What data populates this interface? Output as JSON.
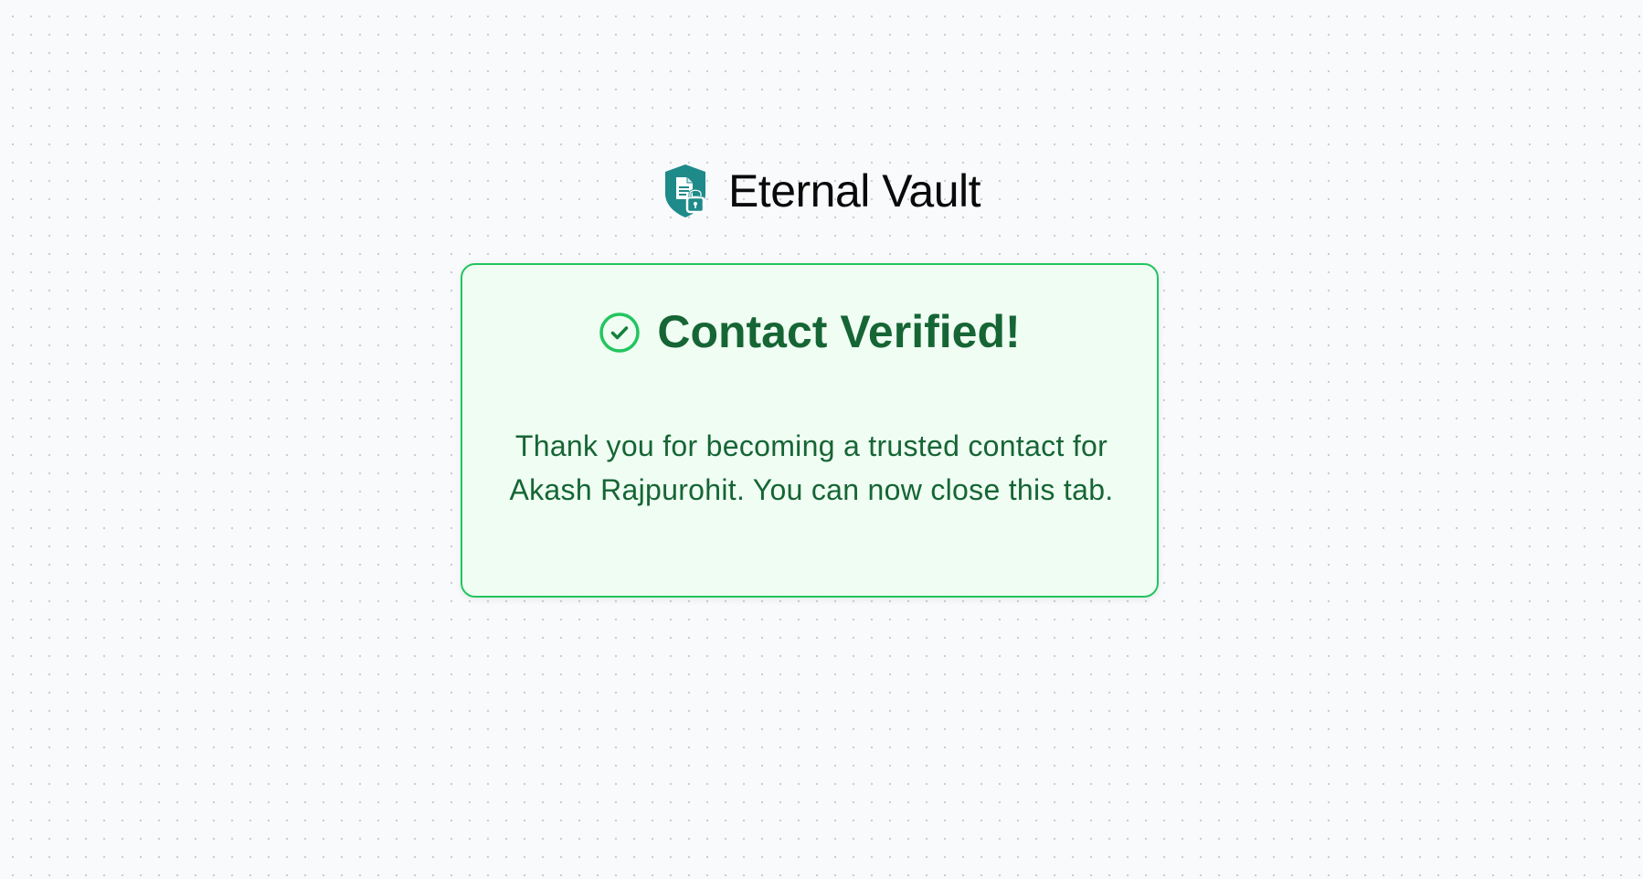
{
  "brand": {
    "name": "Eternal Vault",
    "logo_icon": "shield-document-lock-icon",
    "logo_color": "#1f8a8a"
  },
  "card": {
    "status_icon": "check-circle-icon",
    "title": "Contact Verified!",
    "message": "Thank you for becoming a trusted contact for Akash Rajpurohit. You can now close this tab.",
    "accent_color": "#22c55e",
    "text_color": "#166534",
    "background_color": "#effdf3"
  }
}
